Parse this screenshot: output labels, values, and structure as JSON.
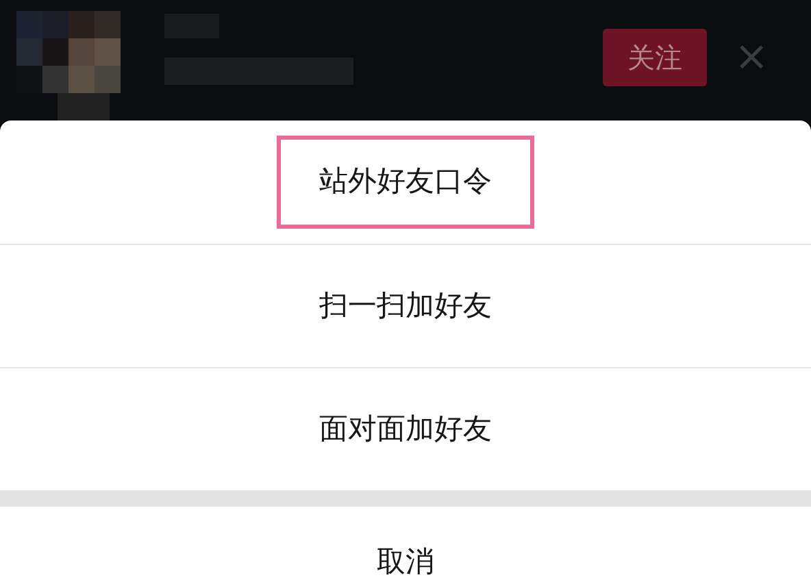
{
  "header": {
    "follow_button": "关注",
    "close_icon": "×"
  },
  "menu": {
    "items": [
      {
        "label": "站外好友口令",
        "highlighted": true
      },
      {
        "label": "扫一扫加好友",
        "highlighted": false
      },
      {
        "label": "面对面加好友",
        "highlighted": false
      }
    ],
    "cancel": "取消"
  }
}
